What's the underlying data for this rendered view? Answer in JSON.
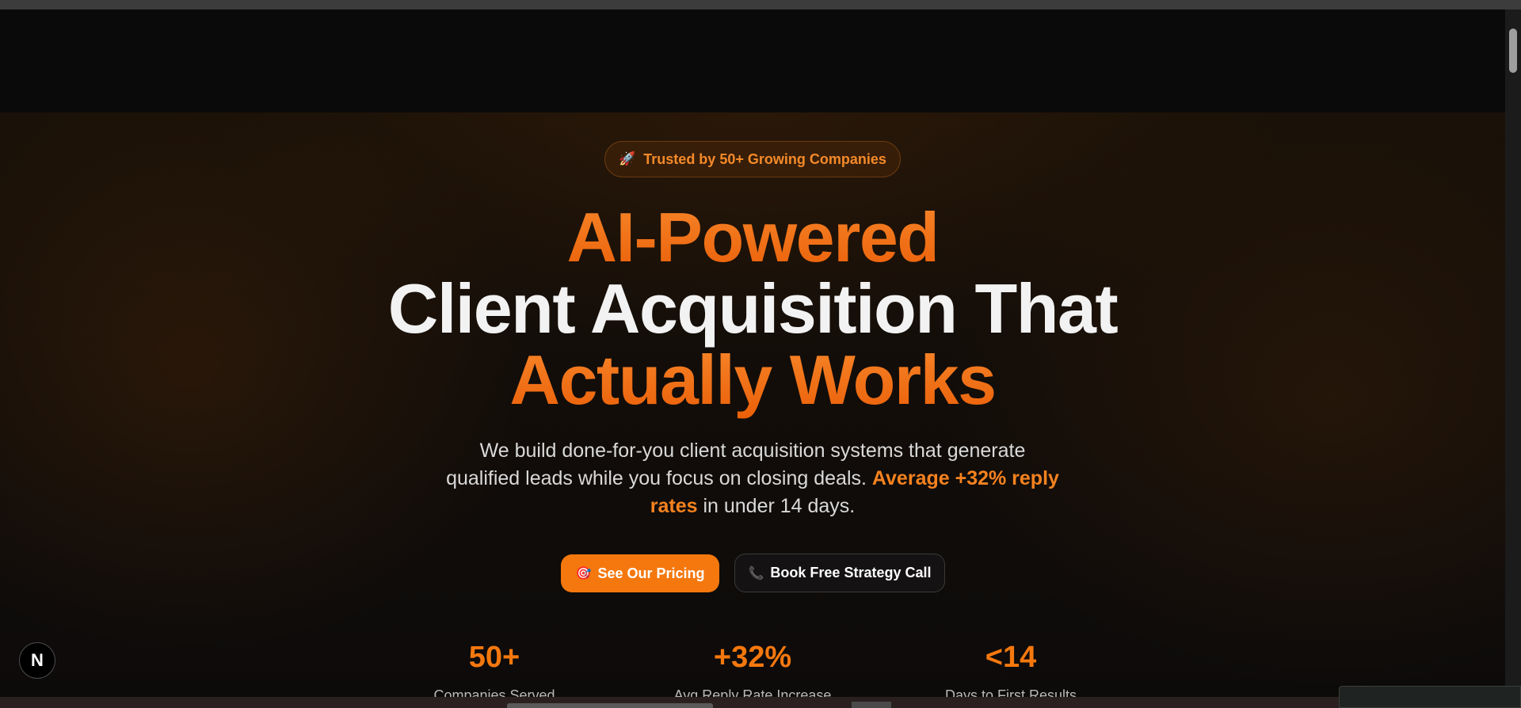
{
  "badge": {
    "icon": "rocket-icon",
    "glyph": "🚀",
    "text": "Trusted by 50+ Growing Companies"
  },
  "headline": {
    "line1": "AI-Powered",
    "line2": "Client Acquisition That",
    "line3": "Actually Works"
  },
  "subtext": {
    "part1": "We build done-for-you client acquisition systems that generate qualified leads while you focus on closing deals.",
    "highlight": "Average +32% reply rates",
    "part2": "in under 14 days."
  },
  "cta": {
    "primary": {
      "icon": "target-icon",
      "glyph": "🎯",
      "label": "See Our Pricing"
    },
    "secondary": {
      "icon": "phone-icon",
      "glyph": "📞",
      "label": "Book Free Strategy Call"
    }
  },
  "stats": [
    {
      "value": "50+",
      "label": "Companies Served"
    },
    {
      "value": "+32%",
      "label": "Avg Reply Rate Increase"
    },
    {
      "value": "<14",
      "label": "Days to First Results"
    }
  ],
  "dev_badge": {
    "icon": "nextjs-icon",
    "letter": "N"
  },
  "colors": {
    "accent": "#f5780e",
    "background": "#0b0b0b",
    "text": "#f2f2f2"
  }
}
